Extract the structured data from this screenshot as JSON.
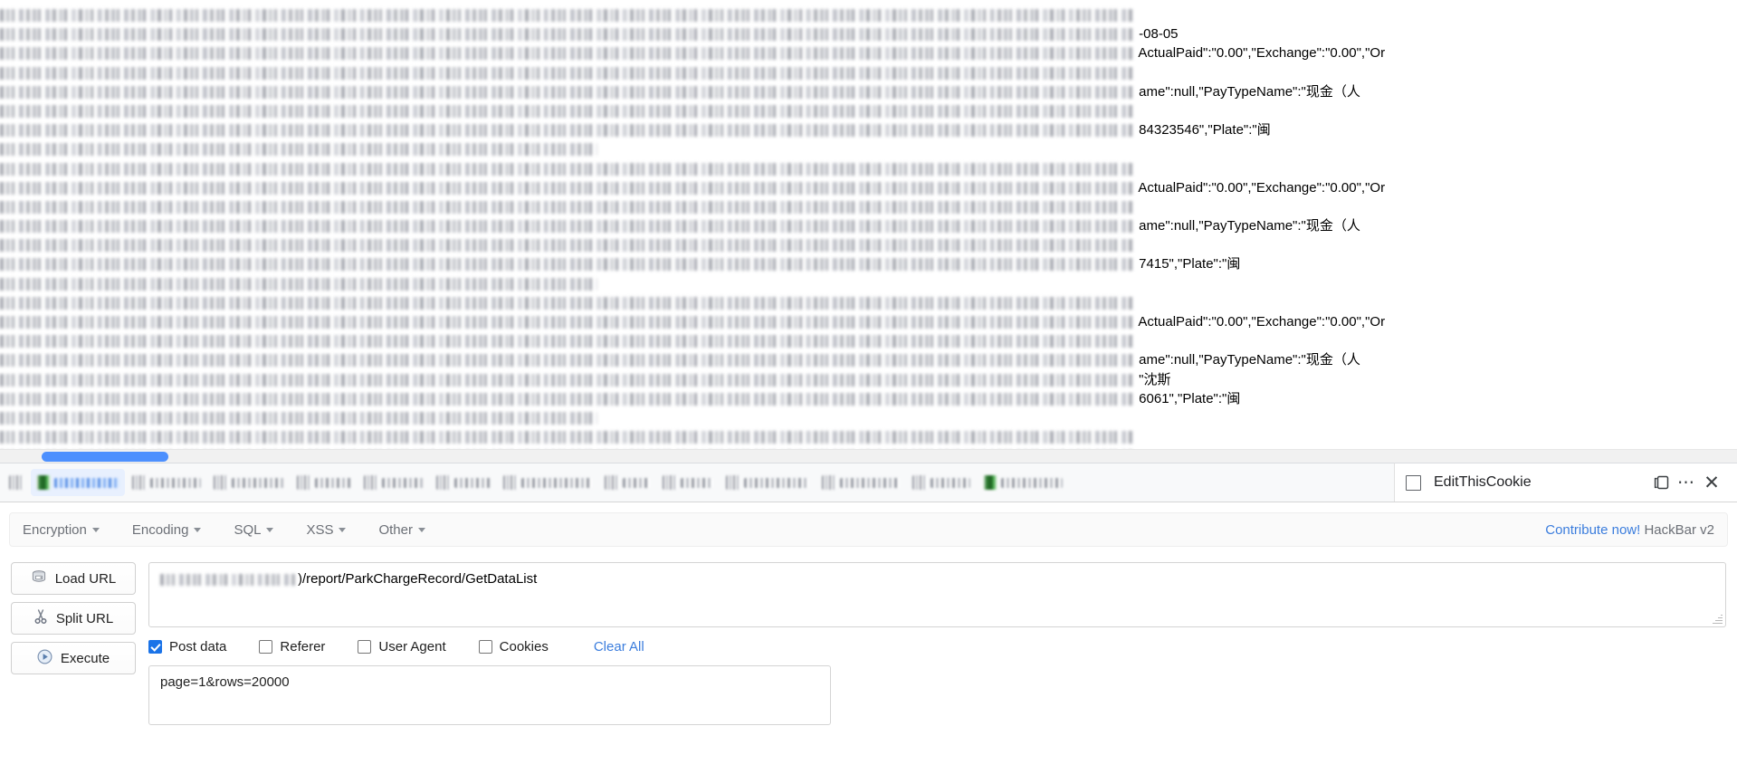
{
  "page_content": {
    "description": "Raw JSON API response for ParkChargeRecord displayed in browser viewport; most content is blurred/redacted",
    "lines": [
      {
        "redacted_widths": [
          1254
        ],
        "text": ""
      },
      {
        "redacted_widths": [
          1254
        ],
        "text": "-08-05"
      },
      {
        "redacted_widths": [
          1254
        ],
        "text": "ActualPaid\":\"0.00\",\"Exchange\":\"0.00\",\"Or"
      },
      {
        "redacted_widths": [
          1254
        ],
        "text": ""
      },
      {
        "redacted_widths": [
          1254
        ],
        "text": "ame\":null,\"PayTypeName\":\"现金（人"
      },
      {
        "redacted_widths": [
          1254
        ],
        "text": ""
      },
      {
        "redacted_widths": [
          1254
        ],
        "text": "84323546\",\"Plate\":\"闽"
      },
      {
        "redacted_widths": [
          660
        ],
        "text": ""
      },
      {
        "redacted_widths": [
          1254
        ],
        "text": ""
      },
      {
        "redacted_widths": [
          1254
        ],
        "text": "ActualPaid\":\"0.00\",\"Exchange\":\"0.00\",\"Or"
      },
      {
        "redacted_widths": [
          1254
        ],
        "text": ""
      },
      {
        "redacted_widths": [
          1254
        ],
        "text": "ame\":null,\"PayTypeName\":\"现金（人"
      },
      {
        "redacted_widths": [
          1254
        ],
        "text": ""
      },
      {
        "redacted_widths": [
          1254
        ],
        "text": "7415\",\"Plate\":\"闽"
      },
      {
        "redacted_widths": [
          660
        ],
        "text": ""
      },
      {
        "redacted_widths": [
          1254
        ],
        "text": ""
      },
      {
        "redacted_widths": [
          1254
        ],
        "text": "ActualPaid\":\"0.00\",\"Exchange\":\"0.00\",\"Or"
      },
      {
        "redacted_widths": [
          1254
        ],
        "text": ""
      },
      {
        "redacted_widths": [
          1254
        ],
        "text": "ame\":null,\"PayTypeName\":\"现金（人"
      },
      {
        "redacted_widths": [
          1254
        ],
        "text": "\"沈斯"
      },
      {
        "redacted_widths": [
          1254
        ],
        "text": "6061\",\"Plate\":\"闽"
      },
      {
        "redacted_widths": [
          660
        ],
        "text": ""
      },
      {
        "redacted_widths": [
          1254
        ],
        "text": ""
      },
      {
        "redacted_widths": [
          1254
        ],
        "text": "ActualPaid\":\"0.00\",\"Exchange\":\"0.00\",\"Or"
      }
    ]
  },
  "bookmark_bar": {
    "items": [
      {
        "icon": "redacted-favicon",
        "label_width": 0,
        "icon_style": "blur",
        "selected": false
      },
      {
        "icon": "redacted-favicon",
        "label_width": 72,
        "icon_style": "green",
        "selected": true
      },
      {
        "icon": "redacted-favicon",
        "label_width": 56,
        "icon_style": "blur",
        "selected": false
      },
      {
        "icon": "redacted-favicon",
        "label_width": 58,
        "icon_style": "blur",
        "selected": false
      },
      {
        "icon": "redacted-favicon",
        "label_width": 40,
        "icon_style": "blur",
        "selected": false
      },
      {
        "icon": "redacted-favicon",
        "label_width": 46,
        "icon_style": "blur",
        "selected": false
      },
      {
        "icon": "redacted-favicon",
        "label_width": 40,
        "icon_style": "blur",
        "selected": false
      },
      {
        "icon": "redacted-favicon",
        "label_width": 78,
        "icon_style": "blur",
        "selected": false
      },
      {
        "icon": "redacted-favicon",
        "label_width": 30,
        "icon_style": "blur",
        "selected": false
      },
      {
        "icon": "redacted-favicon",
        "label_width": 36,
        "icon_style": "blur",
        "selected": false
      },
      {
        "icon": "redacted-favicon",
        "label_width": 72,
        "icon_style": "blur",
        "selected": false
      },
      {
        "icon": "redacted-favicon",
        "label_width": 66,
        "icon_style": "blur",
        "selected": false
      },
      {
        "icon": "redacted-favicon",
        "label_width": 44,
        "icon_style": "blur",
        "selected": false
      },
      {
        "icon": "redacted-favicon",
        "label_width": 68,
        "icon_style": "green",
        "selected": false
      }
    ]
  },
  "devtools_panel": {
    "checkbox_checked": false,
    "title": "EditThisCookie",
    "dock_icon": "dock-window-icon",
    "more_icon": "more-options-icon",
    "close_icon": "close-icon"
  },
  "hackbar": {
    "menu": [
      {
        "label": "Encryption"
      },
      {
        "label": "Encoding"
      },
      {
        "label": "SQL"
      },
      {
        "label": "XSS"
      },
      {
        "label": "Other"
      }
    ],
    "contribute_label": "Contribute now!",
    "version_label": "HackBar v2",
    "buttons": [
      {
        "label": "Load URL",
        "icon": "load-url-icon"
      },
      {
        "label": "Split URL",
        "icon": "scissors-icon"
      },
      {
        "label": "Execute",
        "icon": "play-icon"
      }
    ],
    "url_field": {
      "redacted_prefix_width": 152,
      "value": ")/report/ParkChargeRecord/GetDataList",
      "placeholder": "URL"
    },
    "options": [
      {
        "label": "Post data",
        "checked": true
      },
      {
        "label": "Referer",
        "checked": false
      },
      {
        "label": "User Agent",
        "checked": false
      },
      {
        "label": "Cookies",
        "checked": false
      }
    ],
    "clear_all_label": "Clear All",
    "post_data": {
      "value": "page=1&rows=20000",
      "placeholder": "Post data"
    }
  },
  "colors": {
    "accent_blue": "#3b7ddd",
    "checkbox_blue": "#1a73e8",
    "scrollbar_thumb": "#4d90fe",
    "bookmark_selected": "#e8f0fe"
  }
}
